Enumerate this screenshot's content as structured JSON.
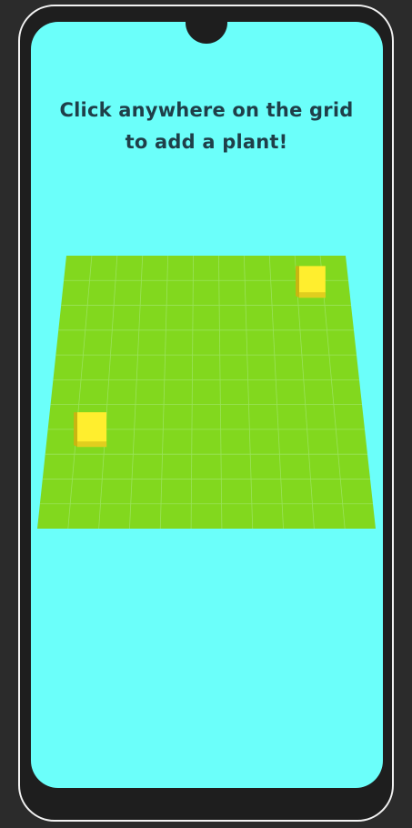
{
  "instruction": {
    "line1": "Click anywhere on the grid",
    "line2": "to add a plant!"
  },
  "colors": {
    "background": "#2b2b2b",
    "device_frame": "#1e1e1e",
    "device_border": "#f2f2f2",
    "screen": "#6bfffa",
    "text": "#1f3f49",
    "grass": "#82d81e",
    "grid_line": "#9ae35a",
    "plant_front": "#ffee2e",
    "plant_side": "#c9b512"
  },
  "grid": {
    "rows": 11,
    "cols": 11
  },
  "plants": [
    {
      "name": "plant-1",
      "row": 1,
      "col": 9
    },
    {
      "name": "plant-2",
      "row": 7,
      "col": 1
    }
  ]
}
